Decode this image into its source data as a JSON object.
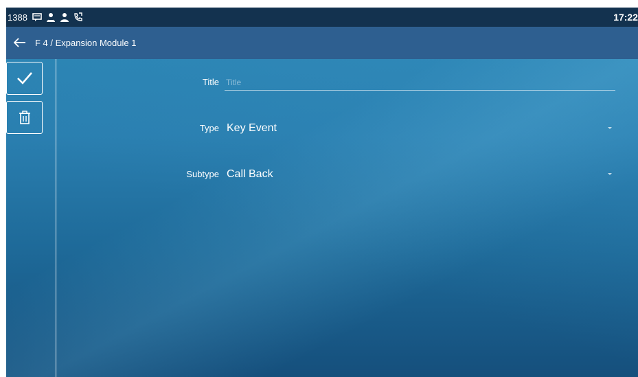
{
  "status_bar": {
    "account_number": "1388",
    "icons": [
      "voicemail-icon",
      "contacts-icon",
      "contact-icon",
      "call-forward-icon"
    ],
    "time": "17:22"
  },
  "header": {
    "back_icon": "back-arrow-icon",
    "breadcrumb": "F 4 / Expansion Module 1"
  },
  "sidebar": {
    "save_icon": "checkmark-icon",
    "delete_icon": "trash-icon"
  },
  "form": {
    "title": {
      "label": "Title",
      "value": "",
      "placeholder": "Title"
    },
    "type": {
      "label": "Type",
      "value": "Key Event"
    },
    "subtype": {
      "label": "Subtype",
      "value": "Call Back"
    }
  },
  "colors": {
    "status_bar": "#13324f",
    "title_bar": "#2e5f90",
    "background_top": "#2b86b4",
    "background_bottom": "#154f7c"
  }
}
